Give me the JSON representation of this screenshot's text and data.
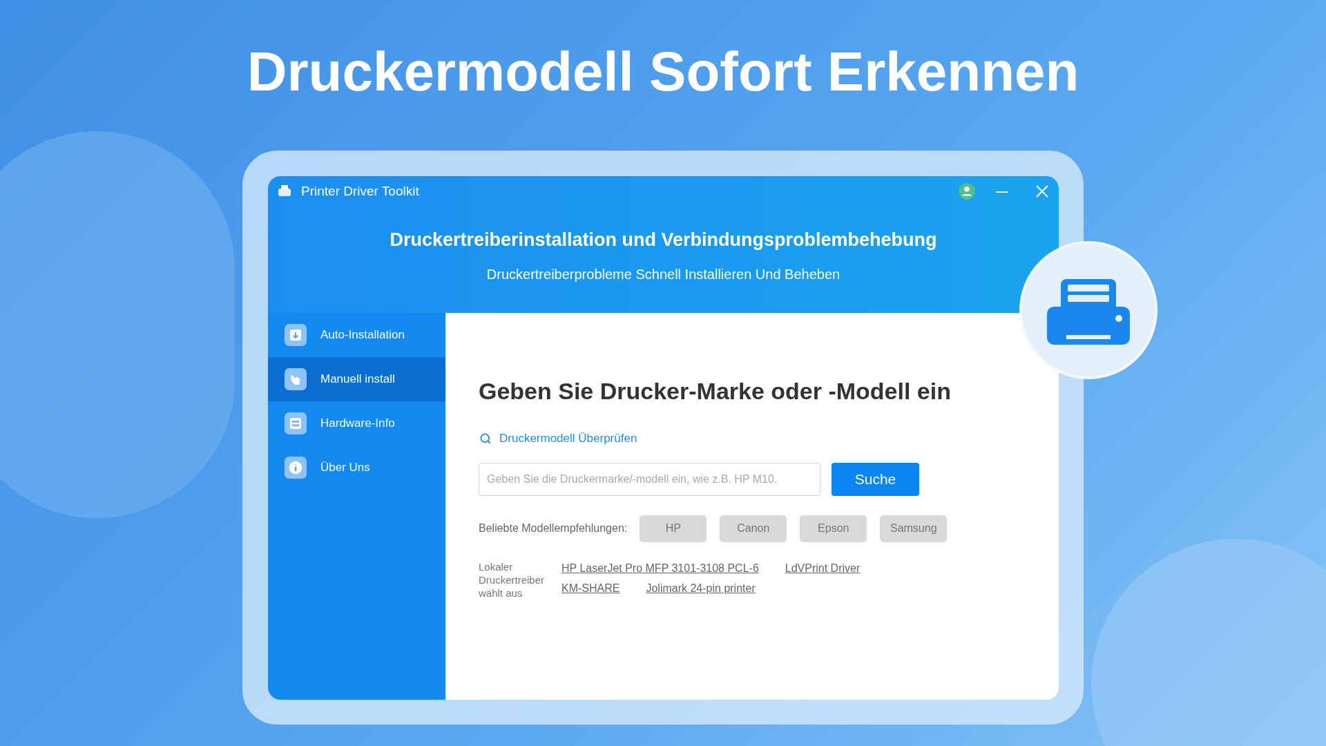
{
  "headline": "Druckermodell Sofort Erkennen",
  "window": {
    "title": "Printer Driver Toolkit"
  },
  "banner": {
    "title": "Druckertreiberinstallation und Verbindungsproblembehebung",
    "subtitle": "Druckertreiberprobleme Schnell Installieren Und Beheben"
  },
  "sidebar": {
    "items": [
      {
        "label": "Auto-Installation",
        "kind": "download",
        "selected": false
      },
      {
        "label": "Manuell install",
        "kind": "hand",
        "selected": true
      },
      {
        "label": "Hardware-Info",
        "kind": "list",
        "selected": false
      },
      {
        "label": "Über Uns",
        "kind": "info",
        "selected": false
      }
    ]
  },
  "main": {
    "heading": "Geben Sie Drucker-Marke oder -Modell ein",
    "check_link": "Druckermodell Überprüfen",
    "search": {
      "placeholder": "Geben Sie die Druckermarke/-modell ein, wie z.B. HP M10."
    },
    "search_button": "Suche",
    "popular_label": "Beliebte Modellempfehlungen:",
    "popular": [
      "HP",
      "Canon",
      "Epson",
      "Samsung"
    ],
    "local_label": "Lokaler Druckertreiber wählt aus",
    "local_drivers": [
      [
        "HP LaserJet Pro MFP 3101-3108 PCL-6",
        "LdVPrint Driver"
      ],
      [
        "KM-SHARE",
        "Jolimark 24-pin printer"
      ]
    ]
  }
}
